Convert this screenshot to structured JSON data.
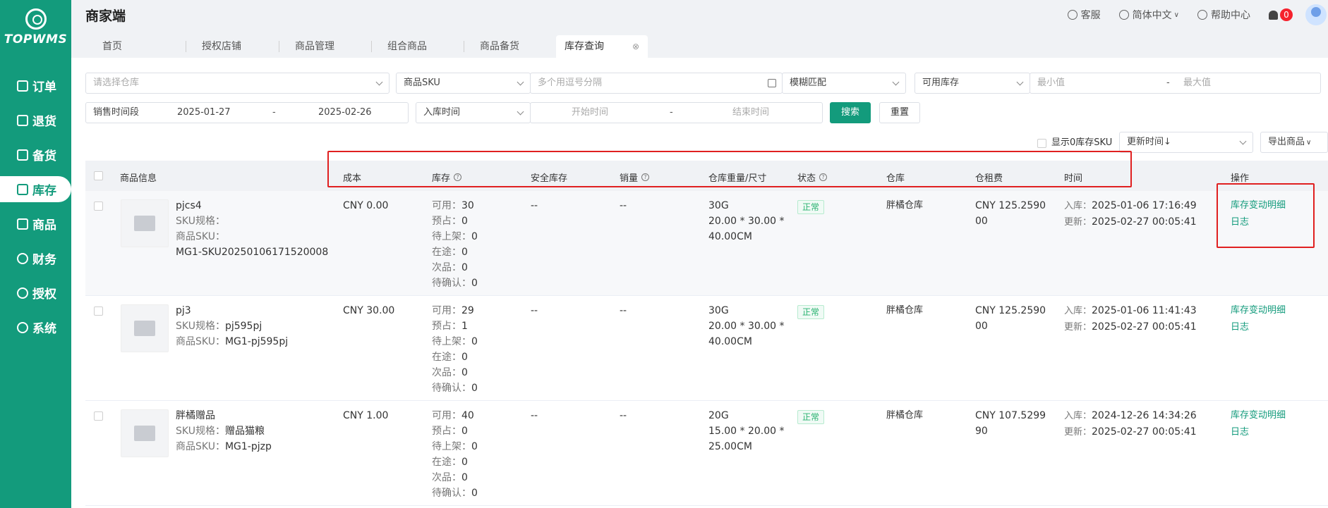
{
  "sidebar": {
    "logo_text": "TOPWMS",
    "items": [
      {
        "label": "订单",
        "icon": "list-icon"
      },
      {
        "label": "退货",
        "icon": "return-icon"
      },
      {
        "label": "备货",
        "icon": "stock-up-icon"
      },
      {
        "label": "库存",
        "icon": "inventory-icon",
        "active": true
      },
      {
        "label": "商品",
        "icon": "bag-icon"
      },
      {
        "label": "财务",
        "icon": "finance-icon"
      },
      {
        "label": "授权",
        "icon": "authorize-icon"
      },
      {
        "label": "系统",
        "icon": "system-icon"
      }
    ]
  },
  "header": {
    "title": "商家端",
    "service": "客服",
    "language": "简体中文",
    "help": "帮助中心",
    "notifications": "0"
  },
  "tabs": [
    {
      "label": "首页"
    },
    {
      "label": "授权店铺"
    },
    {
      "label": "商品管理"
    },
    {
      "label": "组合商品"
    },
    {
      "label": "商品备货"
    },
    {
      "label": "库存查询",
      "active": true
    }
  ],
  "filters": {
    "warehouse_placeholder": "请选择仓库",
    "sku_type": "商品SKU",
    "sku_placeholder": "多个用逗号分隔",
    "match_mode": "模糊匹配",
    "stock_type": "可用库存",
    "min_placeholder": "最小值",
    "range_sep": "-",
    "max_placeholder": "最大值",
    "sales_period_label": "销售时间段",
    "sales_start": "2025-01-27",
    "sales_end": "2025-02-26",
    "time_type": "入库时间",
    "start_placeholder": "开始时间",
    "end_placeholder": "结束时间",
    "search_label": "搜索",
    "reset_label": "重置",
    "show_zero_label": "显示0库存SKU",
    "sort_label": "更新时间↓",
    "export_label": "导出商品"
  },
  "table": {
    "headers": {
      "product": "商品信息",
      "cost": "成本",
      "stock": "库存",
      "safety": "安全库存",
      "sales": "销量",
      "weight": "仓库重量/尺寸",
      "status": "状态",
      "warehouse": "仓库",
      "rent": "仓租费",
      "time": "时间",
      "ops": "操作"
    },
    "labels": {
      "sku_spec": "SKU规格：",
      "sku_code": "商品SKU：",
      "available": "可用：",
      "reserved": "预占：",
      "to_shelve": "待上架：",
      "in_transit": "在途：",
      "defective": "次品：",
      "pending": "待确认：",
      "inbound": "入库：",
      "updated": "更新："
    },
    "rows": [
      {
        "name": "pjcs4",
        "spec": "",
        "sku": "MG1-SKU20250106171520008",
        "cost": "CNY 0.00",
        "available": "30",
        "reserved": "0",
        "to_shelve": "0",
        "in_transit": "0",
        "defective": "0",
        "pending": "0",
        "safety": "--",
        "sales": "--",
        "weight": "30G",
        "dim1": "20.00 * 30.00 *",
        "dim2": "40.00CM",
        "status": "正常",
        "warehouse": "胖橘仓库",
        "rent1": "CNY 125.2590",
        "rent2": "00",
        "inbound": "2025-01-06 17:16:49",
        "updated": "2025-02-27 00:05:41",
        "op1": "库存变动明细",
        "op2": "日志"
      },
      {
        "name": "pj3",
        "spec": "pj595pj",
        "sku": "MG1-pj595pj",
        "cost": "CNY 30.00",
        "available": "29",
        "reserved": "1",
        "to_shelve": "0",
        "in_transit": "0",
        "defective": "0",
        "pending": "0",
        "safety": "--",
        "sales": "--",
        "weight": "30G",
        "dim1": "20.00 * 30.00 *",
        "dim2": "40.00CM",
        "status": "正常",
        "warehouse": "胖橘仓库",
        "rent1": "CNY 125.2590",
        "rent2": "00",
        "inbound": "2025-01-06 11:41:43",
        "updated": "2025-02-27 00:05:41",
        "op1": "库存变动明细",
        "op2": "日志"
      },
      {
        "name": "胖橘赠品",
        "spec": "赠品猫粮",
        "sku": "MG1-pjzp",
        "cost": "CNY 1.00",
        "available": "40",
        "reserved": "0",
        "to_shelve": "0",
        "in_transit": "0",
        "defective": "0",
        "pending": "0",
        "safety": "--",
        "sales": "--",
        "weight": "20G",
        "dim1": "15.00 * 20.00 *",
        "dim2": "25.00CM",
        "status": "正常",
        "warehouse": "胖橘仓库",
        "rent1": "CNY 107.5299",
        "rent2": "90",
        "inbound": "2024-12-26 14:34:26",
        "updated": "2025-02-27 00:05:41",
        "op1": "库存变动明细",
        "op2": "日志"
      }
    ]
  },
  "colors": {
    "brand": "#139b7c",
    "highlight_box": "#e02020",
    "status_ok": "#27b26f"
  }
}
